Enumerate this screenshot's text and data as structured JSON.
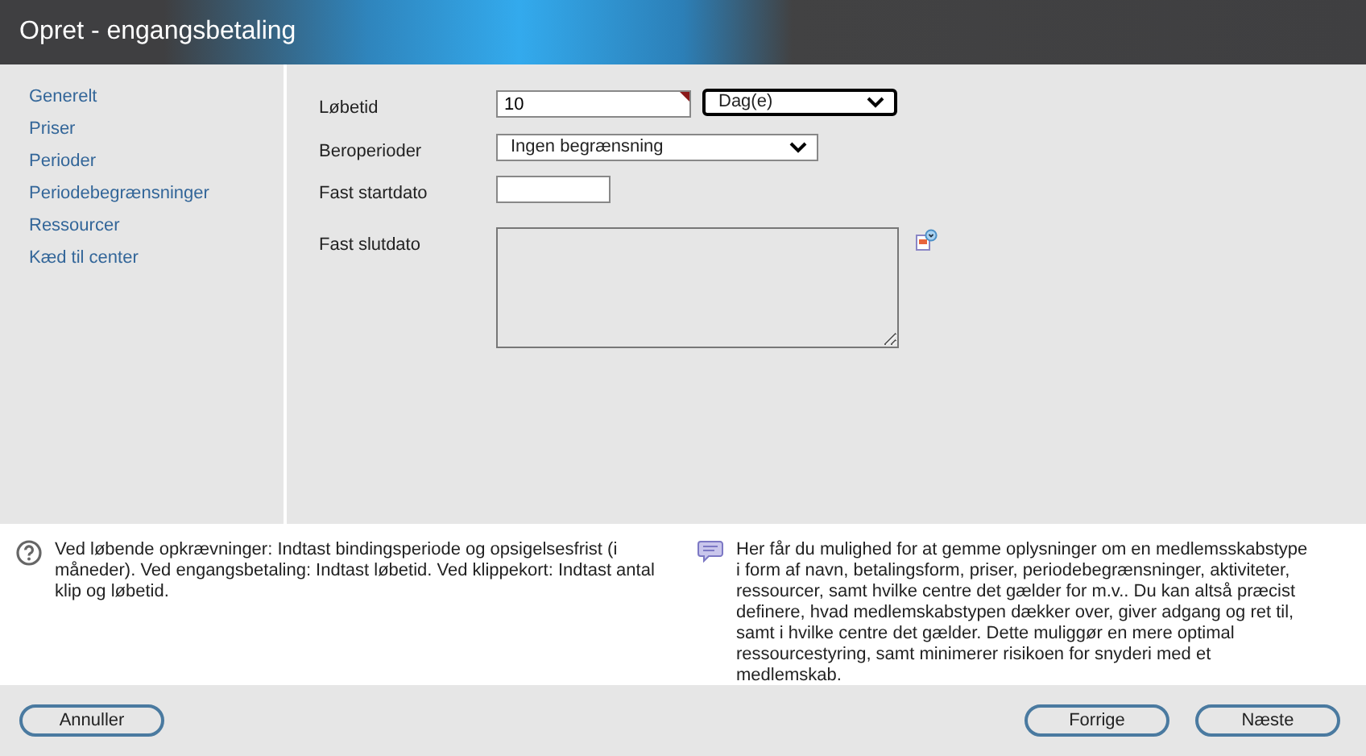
{
  "window": {
    "title": "Opret - engangsbetaling"
  },
  "sidebar": {
    "items": [
      {
        "label": "Generelt"
      },
      {
        "label": "Priser"
      },
      {
        "label": "Perioder"
      },
      {
        "label": "Periodebegrænsninger"
      },
      {
        "label": "Ressourcer"
      },
      {
        "label": "Kæd til center"
      }
    ]
  },
  "form": [
    {
      "kind": "number-unit",
      "label": "Løbetid",
      "value": "10",
      "required": true,
      "unit": "Dag(e)",
      "unit_focused": true
    },
    {
      "kind": "select",
      "label": "Beroperioder",
      "value": "Ingen begrænsning"
    },
    {
      "kind": "date",
      "label": "Fast startdato"
    },
    {
      "kind": "textarea",
      "label": "Fast slutdato"
    }
  ],
  "help": {
    "hint": "Ved løbende opkrævninger: Indtast bindingsperiode og opsigelsesfrist (i måneder). Ved engangsbetaling: Indtast løbetid. Ved klippekort: Indtast antal klip og løbetid.",
    "info": "Her får du mulighed for at gemme oplysninger om en medlemsskabstype i form af navn, betalingsform, priser, periodebegrænsninger, aktiviteter, ressourcer, samt hvilke centre det gælder for m.v.. Du kan altså præcist definere, hvad medlemskabstypen dækker over, giver adgang og ret til, samt i hvilke centre det gælder. Dette muliggør en mere optimal ressourcestyring, samt minimerer risikoen for snyderi med et medlemskab."
  },
  "buttons": {
    "left": [
      "Annuller"
    ],
    "right": [
      "Forrige",
      "Næste"
    ]
  }
}
